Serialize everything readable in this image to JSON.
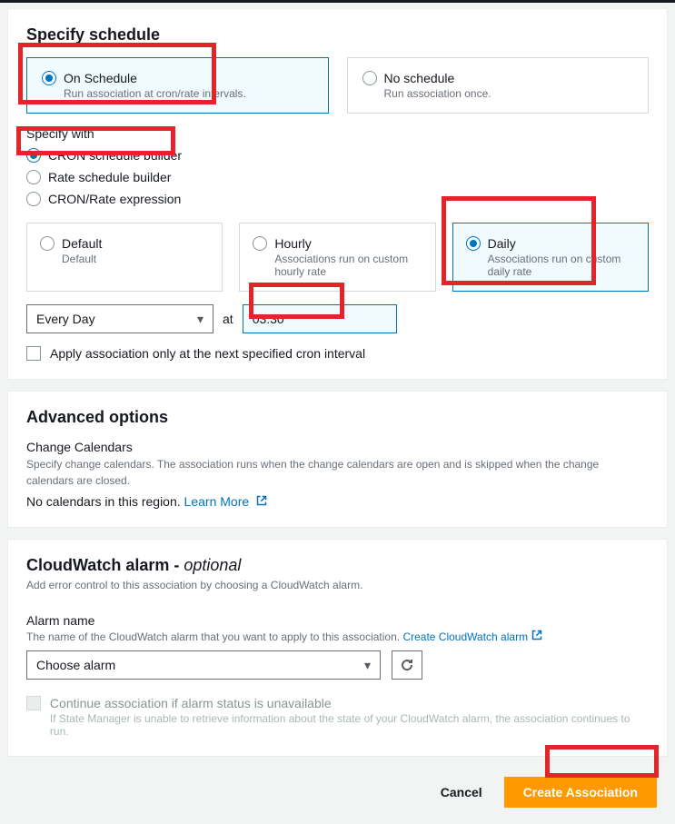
{
  "schedule": {
    "title": "Specify schedule",
    "mode_cards": [
      {
        "title": "On Schedule",
        "desc": "Run association at cron/rate intervals.",
        "selected": true
      },
      {
        "title": "No schedule",
        "desc": "Run association once.",
        "selected": false
      }
    ],
    "specify_with_label": "Specify with",
    "specify_with_options": [
      {
        "label": "CRON schedule builder",
        "selected": true
      },
      {
        "label": "Rate schedule builder",
        "selected": false
      },
      {
        "label": "CRON/Rate expression",
        "selected": false
      }
    ],
    "freq_cards": [
      {
        "title": "Default",
        "desc": "Default",
        "selected": false
      },
      {
        "title": "Hourly",
        "desc": "Associations run on custom hourly rate",
        "selected": false
      },
      {
        "title": "Daily",
        "desc": "Associations run on custom daily rate",
        "selected": true
      }
    ],
    "day_select": "Every Day",
    "at_label": "at",
    "time_value": "03:30",
    "apply_checkbox_label": "Apply association only at the next specified cron interval"
  },
  "advanced": {
    "title": "Advanced options",
    "change_calendars_label": "Change Calendars",
    "change_calendars_desc": "Specify change calendars. The association runs when the change calendars are open and is skipped when the change calendars are closed.",
    "no_calendars_text": "No calendars in this region.",
    "learn_more": "Learn More"
  },
  "cloudwatch": {
    "title_main": "CloudWatch alarm",
    "title_dash": " - ",
    "title_optional": "optional",
    "desc": "Add error control to this association by choosing a CloudWatch alarm.",
    "alarm_name_label": "Alarm name",
    "alarm_name_desc_pre": "The name of the CloudWatch alarm that you want to apply to this association. ",
    "create_alarm_link": "Create CloudWatch alarm",
    "alarm_select_placeholder": "Choose alarm",
    "continue_label": "Continue association if alarm status is unavailable",
    "continue_desc": "If State Manager is unable to retrieve information about the state of your CloudWatch alarm, the association continues to run."
  },
  "footer": {
    "cancel": "Cancel",
    "create": "Create Association"
  }
}
